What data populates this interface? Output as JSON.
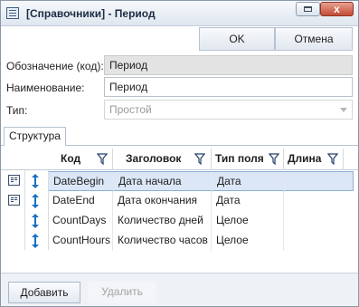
{
  "window": {
    "title": "[Справочники] - Период",
    "close_glyph": "x"
  },
  "toolbar": {
    "ok_label": "OK",
    "cancel_label": "Отмена"
  },
  "form": {
    "code_label": "Обозначение (код):",
    "code_value": "Период",
    "name_label": "Наименование:",
    "name_value": "Период",
    "type_label": "Тип:",
    "type_value": "Простой"
  },
  "tabs": [
    {
      "label": "Структура",
      "active": true
    }
  ],
  "grid": {
    "columns": [
      "Код",
      "Заголовок",
      "Тип поля",
      "Длина"
    ],
    "rows": [
      {
        "code": "DateBegin",
        "title": "Дата начала",
        "type": "Дата",
        "length": "",
        "selected": true,
        "has_icon": true
      },
      {
        "code": "DateEnd",
        "title": "Дата окончания",
        "type": "Дата",
        "length": "",
        "selected": false,
        "has_icon": true
      },
      {
        "code": "CountDays",
        "title": "Количество дней",
        "type": "Целое",
        "length": "",
        "selected": false,
        "has_icon": false
      },
      {
        "code": "CountHours",
        "title": "Количество часов",
        "type": "Целое",
        "length": "",
        "selected": false,
        "has_icon": false
      }
    ]
  },
  "footer": {
    "add_label": "Добавить",
    "delete_label": "Удалить"
  },
  "colors": {
    "title_bg": "#dfe6ef",
    "selection": "#dbe7f6",
    "accent": "#1a6fc4",
    "close": "#c44a32"
  },
  "icons": [
    "app-icon",
    "minimize-icon",
    "close-icon",
    "filter-icon",
    "row-indicator-icon",
    "drag-handle-icon",
    "dropdown-arrow-icon"
  ]
}
